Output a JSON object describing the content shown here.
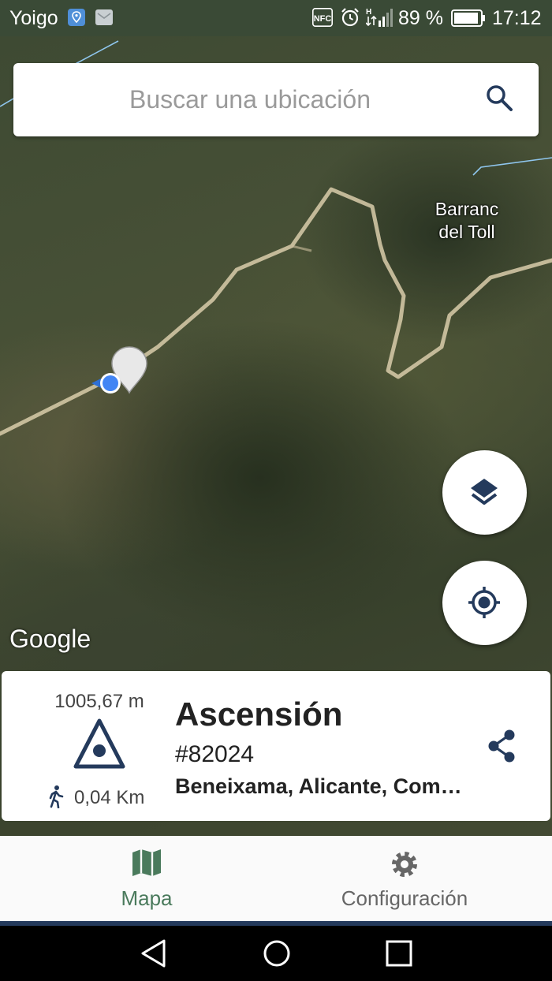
{
  "status_bar": {
    "carrier": "Yoigo",
    "icons": [
      "location-app-icon",
      "message-icon",
      "nfc-icon",
      "alarm-icon",
      "signal-icon",
      "battery-icon"
    ],
    "nfc_label": "NFC",
    "battery_percent": "89 %",
    "time": "17:12"
  },
  "search": {
    "placeholder": "Buscar una ubicación",
    "icon": "search-icon"
  },
  "map": {
    "label": "Barranc del Toll",
    "attribution": "Google",
    "style": "satellite"
  },
  "controls": {
    "layers_icon": "layers-icon",
    "locate_icon": "my-location-icon"
  },
  "info_card": {
    "altitude": "1005,67 m",
    "summit_icon": "summit-triangle-icon",
    "walk_icon": "walking-person-icon",
    "distance": "0,04 Km",
    "name": "Ascensión",
    "id": "#82024",
    "location": "Beneixama, Alicante, Comunidad Valenciana",
    "share_icon": "share-icon"
  },
  "bottom_nav": {
    "items": [
      {
        "label": "Mapa",
        "icon": "map-icon",
        "active": true
      },
      {
        "label": "Configuración",
        "icon": "gear-icon",
        "active": false
      }
    ]
  },
  "colors": {
    "accent": "#4a7a5c",
    "icon_navy": "#243a5c",
    "status_bar": "#3a4a36"
  }
}
